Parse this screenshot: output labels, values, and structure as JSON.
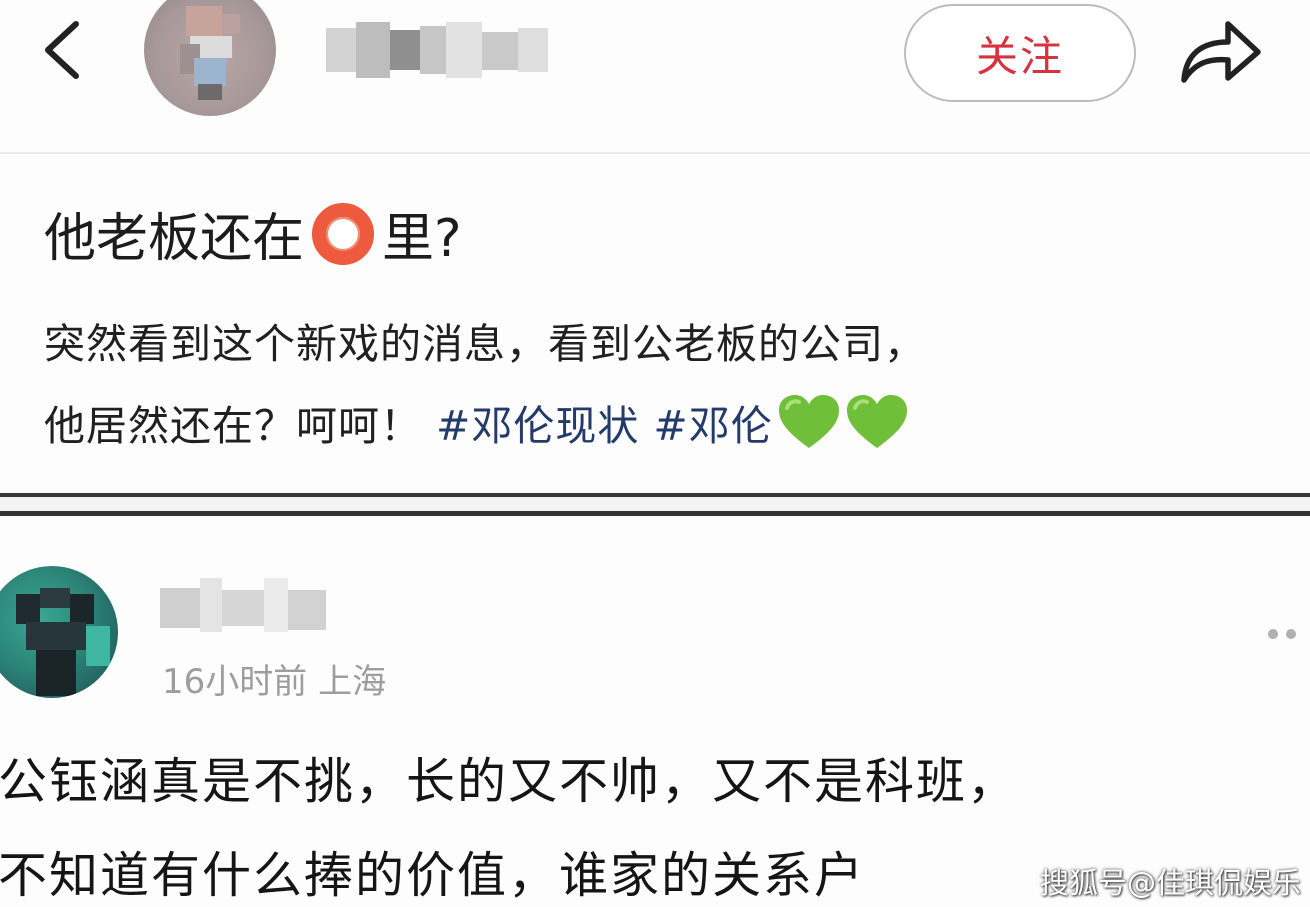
{
  "header": {
    "back_icon": "chevron-left-icon",
    "follow_label": "关注",
    "share_icon": "share-arrow-icon",
    "accent_color": "#d6333f"
  },
  "post": {
    "title_before": "他老板还在",
    "title_icon": "red-ring-icon",
    "title_after": "里?",
    "line1": "突然看到这个新戏的消息，看到公老板的公司，",
    "line2_text": "他居然还在？呵呵！",
    "hashtags": [
      "#邓伦现状",
      "#邓伦"
    ],
    "emoji": [
      "green-heart-icon",
      "green-heart-icon"
    ],
    "tag_color": "#233a6b"
  },
  "comment": {
    "time": "16小时前",
    "location": "上海",
    "more_icon": "more-dots-icon",
    "line1": "公钰涵真是不挑，长的又不帅，又不是科班，",
    "line2": "不知道有什么捧的价值，谁家的关系户"
  },
  "watermark": "搜狐号@佳琪侃娱乐"
}
